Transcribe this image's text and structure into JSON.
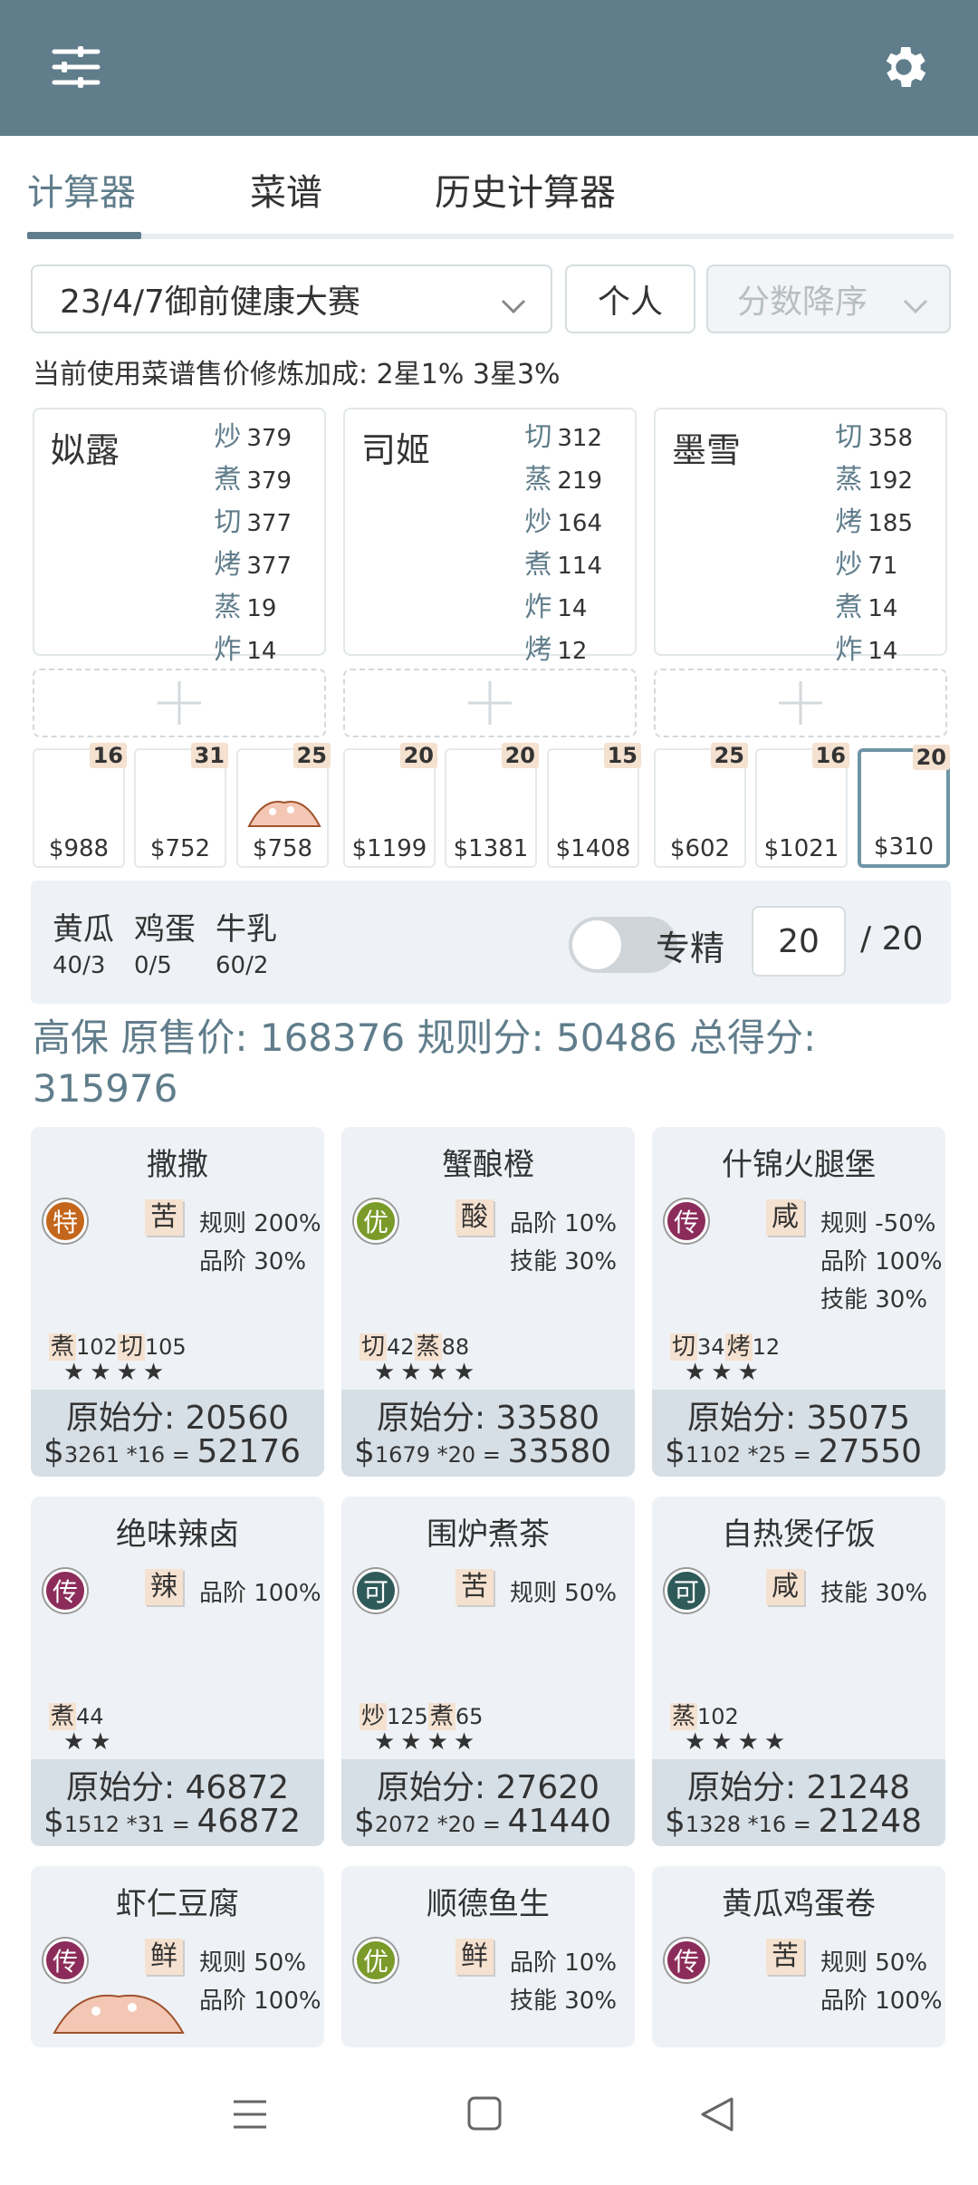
{
  "tabs": [
    "计算器",
    "菜谱",
    "历史计算器"
  ],
  "controls": {
    "event": "23/4/7御前健康大赛",
    "mode": "个人",
    "sort": "分数降序"
  },
  "hint": "当前使用菜谱售价修炼加成: 2星1% 3星3%",
  "chefs": [
    {
      "name": "姒露",
      "skills": [
        [
          "炒",
          "379"
        ],
        [
          "煮",
          "379"
        ],
        [
          "切",
          "377"
        ],
        [
          "烤",
          "377"
        ],
        [
          "蒸",
          "19"
        ],
        [
          "炸",
          "14"
        ]
      ]
    },
    {
      "name": "司姬",
      "skills": [
        [
          "切",
          "312"
        ],
        [
          "蒸",
          "219"
        ],
        [
          "炒",
          "164"
        ],
        [
          "煮",
          "114"
        ],
        [
          "炸",
          "14"
        ],
        [
          "烤",
          "12"
        ]
      ]
    },
    {
      "name": "墨雪",
      "skills": [
        [
          "切",
          "358"
        ],
        [
          "蒸",
          "192"
        ],
        [
          "烤",
          "185"
        ],
        [
          "炒",
          "71"
        ],
        [
          "煮",
          "14"
        ],
        [
          "炸",
          "14"
        ]
      ]
    }
  ],
  "dishes": [
    {
      "count": "16",
      "price": "$988"
    },
    {
      "count": "31",
      "price": "$752"
    },
    {
      "count": "25",
      "price": "$758"
    },
    {
      "count": "20",
      "price": "$1199"
    },
    {
      "count": "20",
      "price": "$1381"
    },
    {
      "count": "15",
      "price": "$1408"
    },
    {
      "count": "25",
      "price": "$602"
    },
    {
      "count": "16",
      "price": "$1021"
    },
    {
      "count": "20",
      "price": "$310"
    }
  ],
  "ingredients": [
    {
      "name": "黄瓜",
      "qty": "40/3"
    },
    {
      "name": "鸡蛋",
      "qty": "0/5"
    },
    {
      "name": "牛乳",
      "qty": "60/2"
    }
  ],
  "specialize": {
    "label": "专精",
    "value": "20",
    "max": "/ 20"
  },
  "summary": "高保 原售价: 168376 规则分: 50486 总得分: 315976",
  "cards": [
    {
      "title": "撒撒",
      "badge": "特",
      "taste": "苦",
      "bonus": [
        "规则 200%",
        "品阶 30%"
      ],
      "skills": [
        [
          "煮",
          "102"
        ],
        [
          "切",
          "105"
        ]
      ],
      "stars": "★★★★",
      "raw": "原始分: 20560",
      "price": "3261",
      "mult": "*16",
      "total": "52176"
    },
    {
      "title": "蟹酿橙",
      "badge": "优",
      "taste": "酸",
      "bonus": [
        "品阶 10%",
        "技能 30%"
      ],
      "skills": [
        [
          "切",
          "42"
        ],
        [
          "蒸",
          "88"
        ]
      ],
      "stars": "★★★★",
      "raw": "原始分: 33580",
      "price": "1679",
      "mult": "*20",
      "total": "33580"
    },
    {
      "title": "什锦火腿堡",
      "badge": "传",
      "taste": "咸",
      "bonus": [
        "规则 -50%",
        "品阶 100%",
        "技能 30%"
      ],
      "skills": [
        [
          "切",
          "34"
        ],
        [
          "烤",
          "12"
        ]
      ],
      "stars": "★★★",
      "raw": "原始分: 35075",
      "price": "1102",
      "mult": "*25",
      "total": "27550"
    },
    {
      "title": "绝味辣卤",
      "badge": "传",
      "taste": "辣",
      "bonus": [
        "品阶 100%"
      ],
      "skills": [
        [
          "煮",
          "44"
        ]
      ],
      "stars": "★★",
      "raw": "原始分: 46872",
      "price": "1512",
      "mult": "*31",
      "total": "46872"
    },
    {
      "title": "围炉煮茶",
      "badge": "可",
      "taste": "苦",
      "bonus": [
        "规则 50%"
      ],
      "skills": [
        [
          "炒",
          "125"
        ],
        [
          "煮",
          "65"
        ]
      ],
      "stars": "★★★★",
      "raw": "原始分: 27620",
      "price": "2072",
      "mult": "*20",
      "total": "41440"
    },
    {
      "title": "自热煲仔饭",
      "badge": "可",
      "taste": "咸",
      "bonus": [
        "技能 30%"
      ],
      "skills": [
        [
          "蒸",
          "102"
        ]
      ],
      "stars": "★★★★",
      "raw": "原始分: 21248",
      "price": "1328",
      "mult": "*16",
      "total": "21248"
    },
    {
      "title": "虾仁豆腐",
      "badge": "传",
      "taste": "鲜",
      "bonus": [
        "规则 50%",
        "品阶 100%"
      ],
      "skills": [],
      "stars": "",
      "raw": "",
      "price": "",
      "mult": "",
      "total": ""
    },
    {
      "title": "顺德鱼生",
      "badge": "优",
      "taste": "鲜",
      "bonus": [
        "品阶 10%",
        "技能 30%"
      ],
      "skills": [],
      "stars": "",
      "raw": "",
      "price": "",
      "mult": "",
      "total": ""
    },
    {
      "title": "黄瓜鸡蛋卷",
      "badge": "传",
      "taste": "苦",
      "bonus": [
        "规则 50%",
        "品阶 100%"
      ],
      "skills": [],
      "stars": "",
      "raw": "",
      "price": "",
      "mult": "",
      "total": ""
    }
  ],
  "badge_colors": {
    "特": "#c4661b",
    "优": "#7a9a2a",
    "传": "#8c2c5a",
    "可": "#2f5a5a"
  }
}
